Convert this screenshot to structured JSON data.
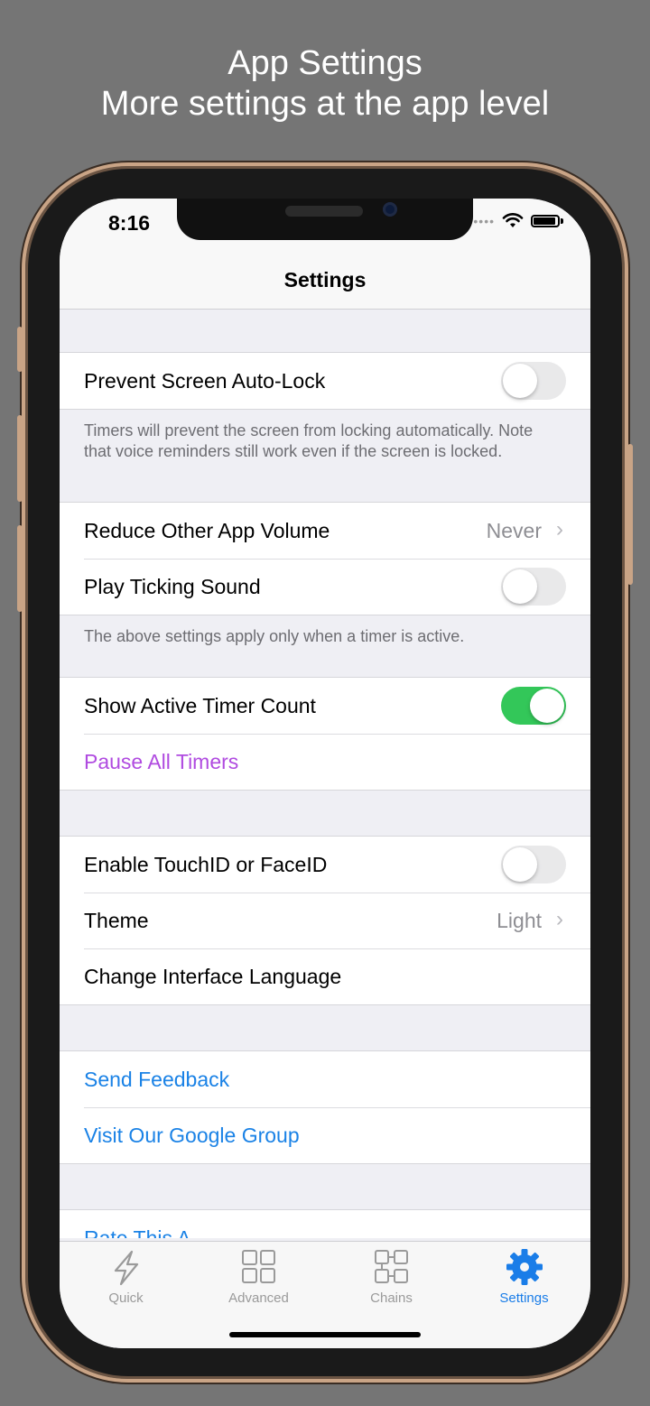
{
  "promo": {
    "title": "App Settings",
    "subtitle": "More settings at the app level"
  },
  "status_bar": {
    "time": "8:16"
  },
  "nav": {
    "title": "Settings"
  },
  "sections": {
    "lock": {
      "prevent_label": "Prevent Screen Auto-Lock",
      "prevent_on": false,
      "footer": "Timers will prevent the screen from locking automatically. Note that voice reminders still work even if the screen is locked."
    },
    "sound": {
      "reduce_label": "Reduce Other App Volume",
      "reduce_value": "Never",
      "ticking_label": "Play Ticking Sound",
      "ticking_on": false,
      "footer": "The above settings apply only when a timer is active."
    },
    "timers": {
      "show_count_label": "Show Active Timer Count",
      "show_count_on": true,
      "pause_all_label": "Pause All Timers"
    },
    "app": {
      "biometric_label": "Enable TouchID or FaceID",
      "biometric_on": false,
      "theme_label": "Theme",
      "theme_value": "Light",
      "language_label": "Change Interface Language"
    },
    "support": {
      "feedback_label": "Send Feedback",
      "group_label": "Visit Our Google Group",
      "partial_label": "Rate This A"
    }
  },
  "tab_bar": {
    "tabs": [
      {
        "label": "Quick",
        "icon": "lightning-icon",
        "active": false
      },
      {
        "label": "Advanced",
        "icon": "grid-icon",
        "active": false
      },
      {
        "label": "Chains",
        "icon": "chain-grid-icon",
        "active": false
      },
      {
        "label": "Settings",
        "icon": "gear-icon",
        "active": true
      }
    ]
  },
  "colors": {
    "background": "#757575",
    "toggle_on": "#33c759",
    "link_blue": "#1a82e6",
    "link_purple": "#b04be0",
    "tab_active": "#1a7de8"
  }
}
